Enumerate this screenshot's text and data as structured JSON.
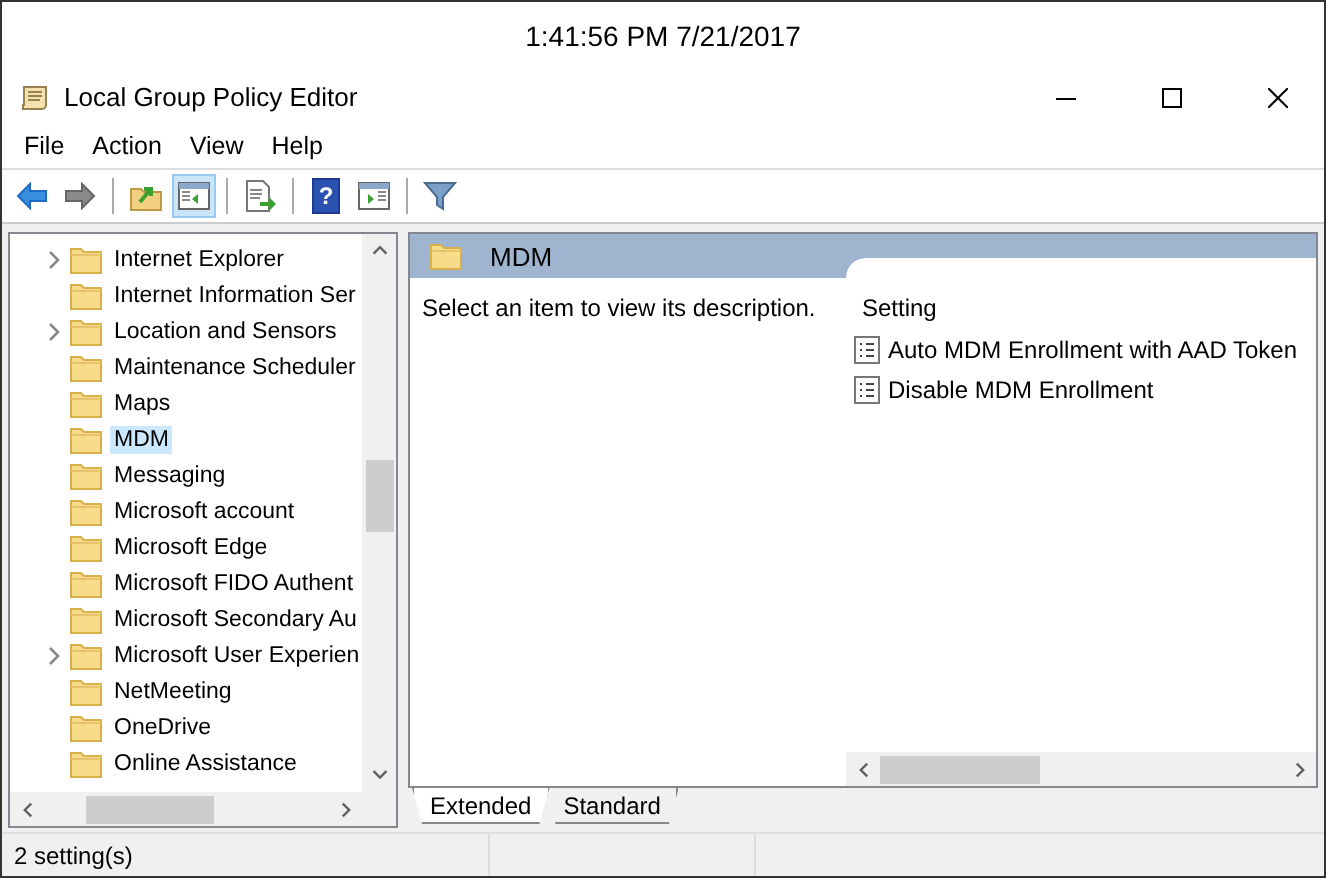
{
  "clock": "1:41:56 PM 7/21/2017",
  "window": {
    "title": "Local Group Policy Editor"
  },
  "menu": [
    "File",
    "Action",
    "View",
    "Help"
  ],
  "toolbar": [
    [
      {
        "kind": "back",
        "pressed": false
      },
      {
        "kind": "forward",
        "pressed": false
      }
    ],
    [
      {
        "kind": "up",
        "pressed": false
      },
      {
        "kind": "pane",
        "pressed": true
      }
    ],
    [
      {
        "kind": "export",
        "pressed": false
      }
    ],
    [
      {
        "kind": "help",
        "glyph": "?",
        "pressed": false
      },
      {
        "kind": "show",
        "pressed": false
      }
    ],
    [
      {
        "kind": "filter",
        "pressed": false
      }
    ]
  ],
  "tree": [
    {
      "label": "Internet Explorer",
      "expandable": true,
      "selected": false
    },
    {
      "label": "Internet Information Ser",
      "expandable": false,
      "selected": false
    },
    {
      "label": "Location and Sensors",
      "expandable": true,
      "selected": false
    },
    {
      "label": "Maintenance Scheduler",
      "expandable": false,
      "selected": false
    },
    {
      "label": "Maps",
      "expandable": false,
      "selected": false
    },
    {
      "label": "MDM",
      "expandable": false,
      "selected": true
    },
    {
      "label": "Messaging",
      "expandable": false,
      "selected": false
    },
    {
      "label": "Microsoft account",
      "expandable": false,
      "selected": false
    },
    {
      "label": "Microsoft Edge",
      "expandable": false,
      "selected": false
    },
    {
      "label": "Microsoft FIDO Authent",
      "expandable": false,
      "selected": false
    },
    {
      "label": "Microsoft Secondary Au",
      "expandable": false,
      "selected": false
    },
    {
      "label": "Microsoft User Experien",
      "expandable": true,
      "selected": false
    },
    {
      "label": "NetMeeting",
      "expandable": false,
      "selected": false
    },
    {
      "label": "OneDrive",
      "expandable": false,
      "selected": false
    },
    {
      "label": "Online Assistance",
      "expandable": false,
      "selected": false
    }
  ],
  "main": {
    "header": "MDM",
    "description": "Select an item to view its description.",
    "column": "Setting",
    "settings": [
      "Auto MDM Enrollment with AAD Token",
      "Disable MDM Enrollment"
    ]
  },
  "tabs": [
    {
      "label": "Extended",
      "selected": true
    },
    {
      "label": "Standard",
      "selected": false
    }
  ],
  "status_bar": "2 setting(s)"
}
